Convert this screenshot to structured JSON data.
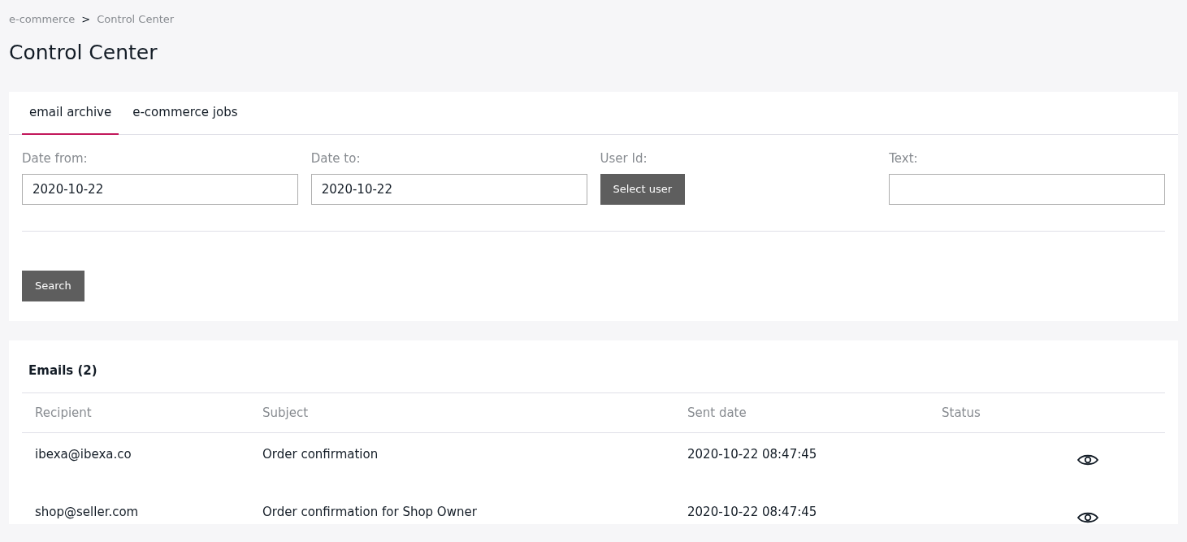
{
  "breadcrumb": [
    {
      "label": "e-commerce"
    },
    {
      "label": "Control Center"
    }
  ],
  "breadcrumb_separator": ">",
  "title": "Control Center",
  "tabs": [
    {
      "label": "email archive",
      "selected": true
    },
    {
      "label": "e-commerce jobs",
      "selected": false
    }
  ],
  "filters": [
    {
      "kind": "input",
      "label": "Date from:",
      "value": "2020-10-22"
    },
    {
      "kind": "input",
      "label": "Date to:",
      "value": "2020-10-22"
    },
    {
      "kind": "button",
      "label": "User Id:",
      "button": "Select user"
    },
    {
      "kind": "input",
      "label": "Text:"
    }
  ],
  "search_button": "Search",
  "emails": {
    "heading": "Emails (2)",
    "columns": [
      "Recipient",
      "Subject",
      "Sent date",
      "Status"
    ],
    "rows": [
      {
        "recipient": "ibexa@ibexa.co",
        "subject": "Order confirmation",
        "sent_date": "2020-10-22 08:47:45"
      },
      {
        "recipient": "shop@seller.com",
        "subject": "Order confirmation for Shop Owner",
        "sent_date": "2020-10-22 08:47:45"
      }
    ]
  }
}
